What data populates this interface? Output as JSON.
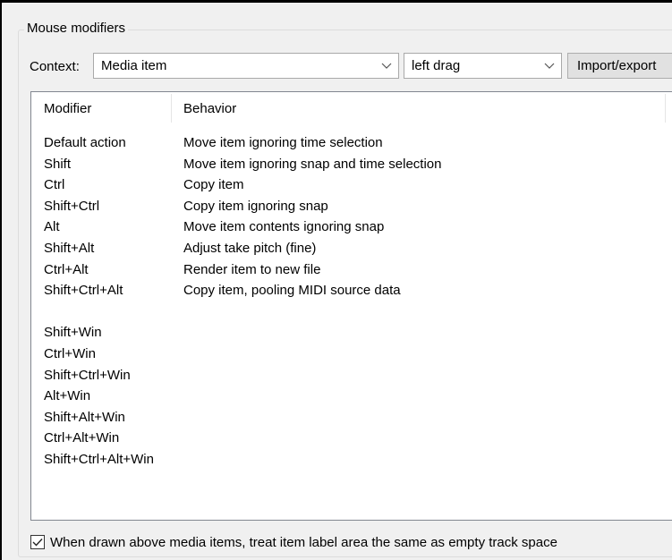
{
  "group_title": "Mouse modifiers",
  "context": {
    "label": "Context:",
    "selected": "Media item",
    "action_selected": "left drag"
  },
  "import_export_label": "Import/export",
  "table": {
    "headers": [
      "Modifier",
      "Behavior"
    ],
    "rows": [
      {
        "modifier": "Default action",
        "behavior": "Move item ignoring time selection"
      },
      {
        "modifier": "Shift",
        "behavior": "Move item ignoring snap and time selection"
      },
      {
        "modifier": "Ctrl",
        "behavior": "Copy item"
      },
      {
        "modifier": "Shift+Ctrl",
        "behavior": "Copy item ignoring snap"
      },
      {
        "modifier": "Alt",
        "behavior": "Move item contents ignoring snap"
      },
      {
        "modifier": "Shift+Alt",
        "behavior": "Adjust take pitch (fine)"
      },
      {
        "modifier": "Ctrl+Alt",
        "behavior": "Render item to new file"
      },
      {
        "modifier": "Shift+Ctrl+Alt",
        "behavior": "Copy item, pooling MIDI source data"
      },
      {
        "modifier": "Shift+Win",
        "behavior": ""
      },
      {
        "modifier": "Ctrl+Win",
        "behavior": ""
      },
      {
        "modifier": "Shift+Ctrl+Win",
        "behavior": ""
      },
      {
        "modifier": "Alt+Win",
        "behavior": ""
      },
      {
        "modifier": "Shift+Alt+Win",
        "behavior": ""
      },
      {
        "modifier": "Ctrl+Alt+Win",
        "behavior": ""
      },
      {
        "modifier": "Shift+Ctrl+Alt+Win",
        "behavior": ""
      }
    ]
  },
  "checkbox": {
    "checked": true,
    "label": "When drawn above media items, treat item label area the same as empty track space"
  }
}
